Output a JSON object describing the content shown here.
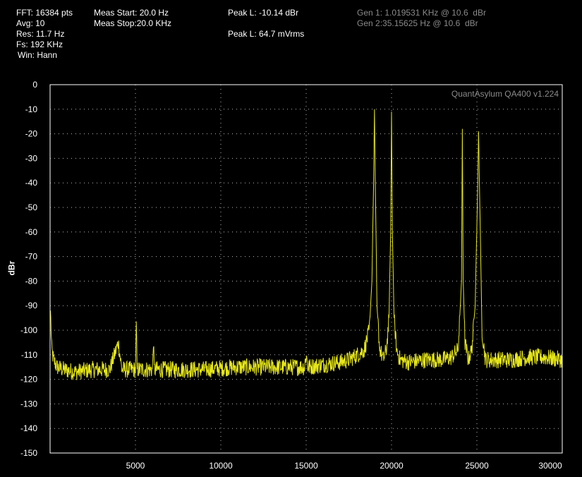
{
  "stats": {
    "fft": "FFT: 16384 pts",
    "avg": "Avg: 10",
    "res": "Res: 11.7 Hz",
    "fs": "Fs: 192 KHz",
    "win": "Win: Hann"
  },
  "meas": {
    "start": "Meas Start: 20.0 Hz",
    "stop": "Meas Stop:20.0 KHz"
  },
  "peaks": {
    "dbr": "Peak L: -10.14 dBr",
    "mvrms": "Peak L: 64.7 mVrms"
  },
  "generators": {
    "gen1": "Gen 1: 1.019531 KHz @ 10.6  dBr",
    "gen2": "Gen 2:35.15625 Hz @ 10.6  dBr"
  },
  "watermark": "QuantAsylum QA400 v1.224",
  "colors": {
    "trace": "#e6e619",
    "grid": "#b8b8b8",
    "frame": "#ffffff",
    "background": "#000000"
  },
  "chart_data": {
    "type": "line",
    "ylabel": "dBr",
    "xlabel": "",
    "xlim": [
      0,
      30000
    ],
    "ylim": [
      -150,
      0
    ],
    "x_ticks": [
      5000,
      10000,
      15000,
      20000,
      25000,
      30000
    ],
    "y_ticks": [
      0,
      -10,
      -20,
      -30,
      -40,
      -50,
      -60,
      -70,
      -80,
      -90,
      -100,
      -110,
      -120,
      -130,
      -140,
      -150
    ],
    "grid": true,
    "series": [
      {
        "x": [
          20,
          100,
          200,
          400,
          800,
          1500,
          2500,
          3500,
          4000,
          4200,
          4400,
          5000,
          5050,
          5100,
          6000,
          6050,
          6100,
          7000,
          9000,
          11000,
          13000,
          14900,
          15000,
          15100,
          16000,
          17000,
          17500,
          18000,
          18400,
          18700,
          18850,
          18950,
          19000,
          19050,
          19150,
          19300,
          19500,
          19700,
          19850,
          19950,
          20000,
          20050,
          20150,
          20300,
          20500,
          21000,
          22000,
          23000,
          23500,
          23900,
          24100,
          24150,
          24200,
          24300,
          24500,
          24700,
          24900,
          25050,
          25100,
          25150,
          25300,
          25500,
          26000,
          27000,
          28000,
          29000,
          30000
        ],
        "y": [
          -92,
          -108,
          -112,
          -115,
          -116,
          -117,
          -116,
          -116,
          -105,
          -116,
          -116,
          -116,
          -98,
          -116,
          -116,
          -104,
          -116,
          -116,
          -116,
          -115,
          -115,
          -115,
          -110,
          -115,
          -114,
          -113,
          -112,
          -110,
          -108,
          -100,
          -80,
          -40,
          -10,
          -40,
          -90,
          -107,
          -112,
          -108,
          -95,
          -60,
          -11,
          -60,
          -95,
          -108,
          -112,
          -113,
          -112,
          -112,
          -111,
          -108,
          -80,
          -18,
          -80,
          -105,
          -112,
          -108,
          -90,
          -40,
          -19,
          -40,
          -100,
          -112,
          -112,
          -112,
          -111,
          -111,
          -112
        ]
      }
    ]
  }
}
